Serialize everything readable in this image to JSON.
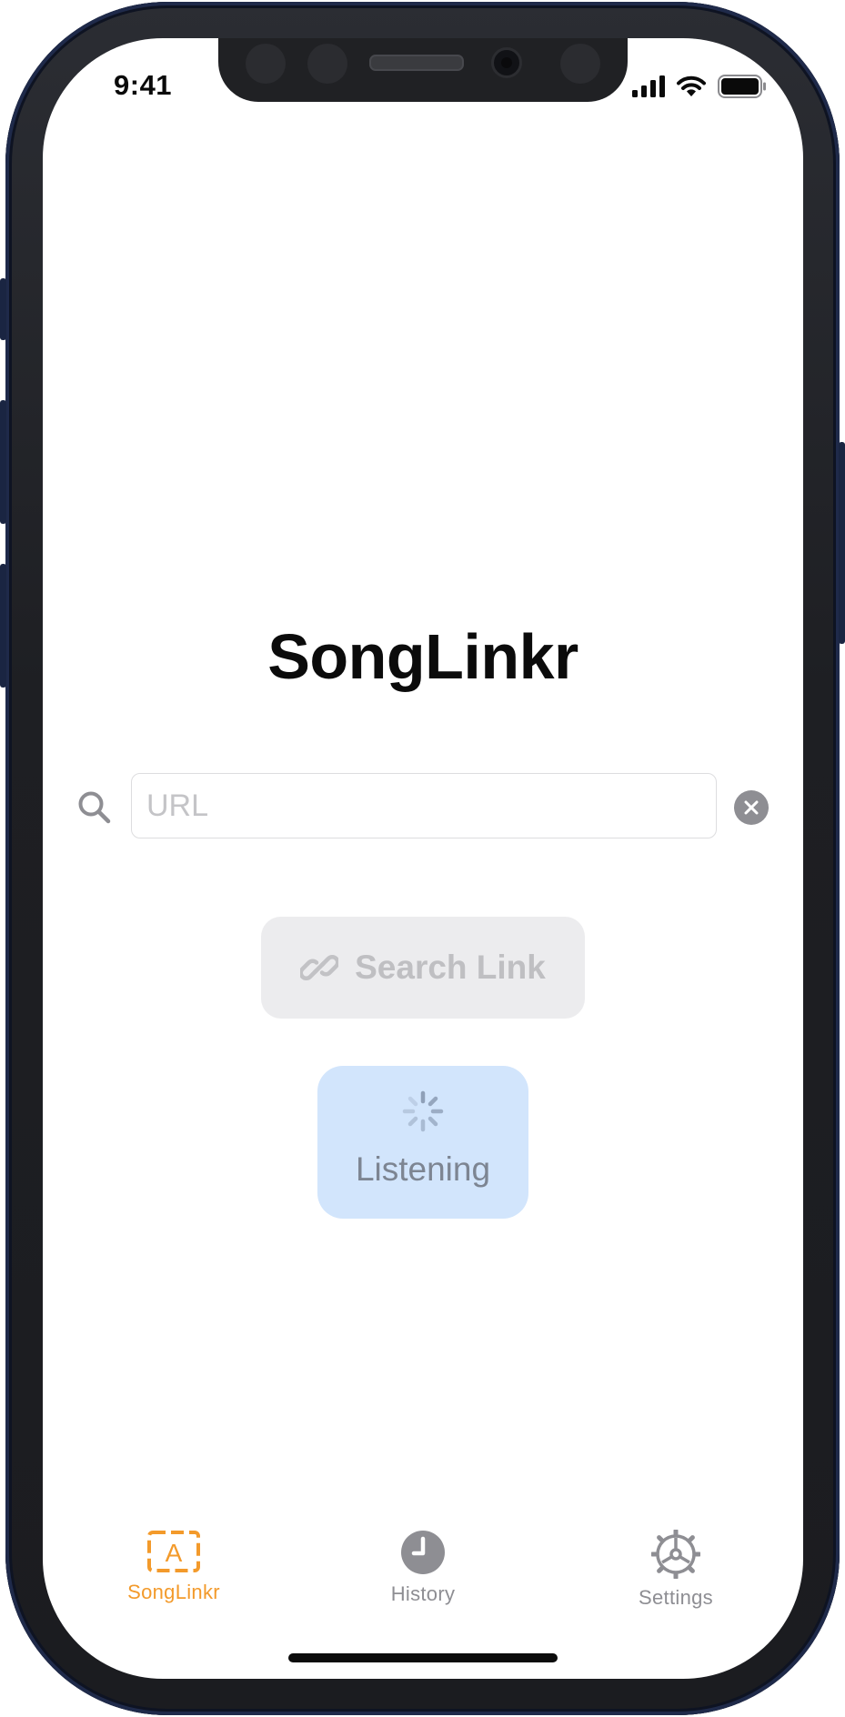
{
  "status_bar": {
    "time": "9:41"
  },
  "app": {
    "title": "SongLinkr"
  },
  "search": {
    "placeholder": "URL",
    "value": ""
  },
  "buttons": {
    "search_link_label": "Search Link",
    "listening_label": "Listening"
  },
  "tab_bar": {
    "items": [
      {
        "label": "SongLinkr",
        "icon": "songlinkr-icon",
        "active": true
      },
      {
        "label": "History",
        "icon": "clock-icon",
        "active": false
      },
      {
        "label": "Settings",
        "icon": "gear-icon",
        "active": false
      }
    ]
  },
  "colors": {
    "accent": "#f39a2b",
    "inactive": "#8e8e93",
    "listening_bg": "#d2e5fc",
    "disabled_bg": "#ececee"
  }
}
